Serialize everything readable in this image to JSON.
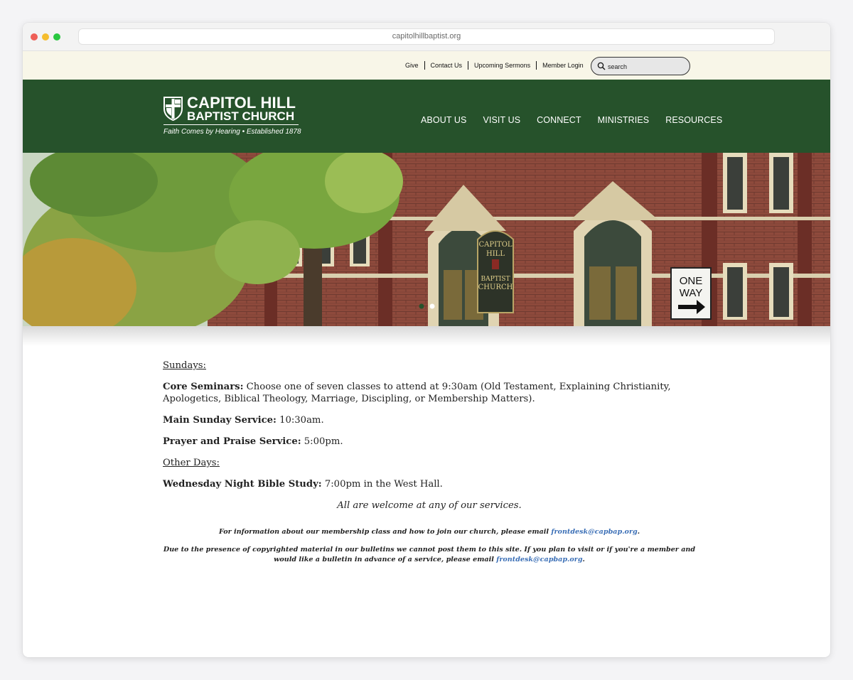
{
  "browser": {
    "url": "capitolhillbaptist.org"
  },
  "utility": {
    "links": [
      "Give",
      "Contact Us",
      "Upcoming Sermons",
      "Member Login"
    ],
    "search_placeholder": "search"
  },
  "logo": {
    "line1": "CAPITOL HILL",
    "line2": "BAPTIST CHURCH",
    "tagline": "Faith Comes by Hearing • Established 1878"
  },
  "nav": [
    "ABOUT US",
    "VISIT US",
    "CONNECT",
    "MINISTRIES",
    "RESOURCES"
  ],
  "hero": {
    "sign_lines": [
      "CAPITOL",
      "HILL",
      "BAPTIST",
      "CHURCH"
    ],
    "street_sign": [
      "ONE",
      "WAY"
    ],
    "slides_total": 2,
    "active_slide": 1
  },
  "content": {
    "sundays_heading": "Sundays:",
    "core_label": "Core Seminars:",
    "core_text": " Choose one of seven classes to attend at 9:30am (Old Testament, Explaining Christianity, Apologetics, Biblical Theology, Marriage, Discipling, or Membership Matters).",
    "main_label": "Main Sunday Service:",
    "main_text": " 10:30am.",
    "prayer_label": "Prayer and Praise Service:",
    "prayer_text": " 5:00pm.",
    "other_heading": "Other Days:",
    "wed_label": "Wednesday Night Bible Study:",
    "wed_text": " 7:00pm in the West Hall.",
    "welcome": "All are welcome at any of our services.",
    "membership_text": "For information about our membership class and how to join our church, please email ",
    "membership_email": "frontdesk@capbap.org",
    "membership_end": ".",
    "bulletin_text": "Due to the presence of copyrighted material in our bulletins we cannot post them to this site. If you plan to visit or if you're a member and would like a bulletin in advance of a service, please email ",
    "bulletin_email": "frontdesk@capbap.org",
    "bulletin_end": "."
  },
  "colors": {
    "header_green": "#26522b",
    "utility_bg": "#f8f6e8",
    "link_blue": "#3b6fb6"
  }
}
